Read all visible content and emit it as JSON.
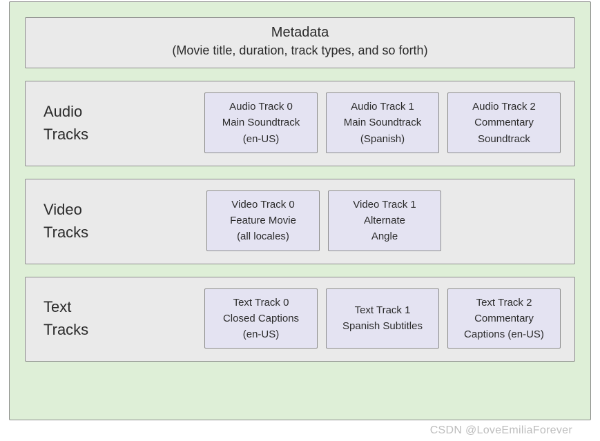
{
  "metadata": {
    "title": "Metadata",
    "subtitle": "(Movie title, duration, track types, and so forth)"
  },
  "sections": [
    {
      "label_line1": "Audio",
      "label_line2": "Tracks",
      "tracks": [
        {
          "l1": "Audio Track 0",
          "l2": "Main Soundtrack",
          "l3": "(en-US)"
        },
        {
          "l1": "Audio Track 1",
          "l2": "Main Soundtrack",
          "l3": "(Spanish)"
        },
        {
          "l1": "Audio Track 2",
          "l2": "Commentary",
          "l3": "Soundtrack"
        }
      ]
    },
    {
      "label_line1": "Video",
      "label_line2": "Tracks",
      "tracks": [
        {
          "l1": "Video Track 0",
          "l2": "Feature Movie",
          "l3": "(all locales)"
        },
        {
          "l1": "Video Track 1",
          "l2": "Alternate",
          "l3": "Angle"
        }
      ]
    },
    {
      "label_line1": "Text",
      "label_line2": "Tracks",
      "tracks": [
        {
          "l1": "Text Track  0",
          "l2": "Closed Captions",
          "l3": "(en-US)"
        },
        {
          "l1": "Text Track  1",
          "l2": "Spanish Subtitles",
          "l3": ""
        },
        {
          "l1": "Text Track  2",
          "l2": "Commentary",
          "l3": "Captions (en-US)"
        }
      ]
    }
  ],
  "watermark": "CSDN @LoveEmiliaForever"
}
